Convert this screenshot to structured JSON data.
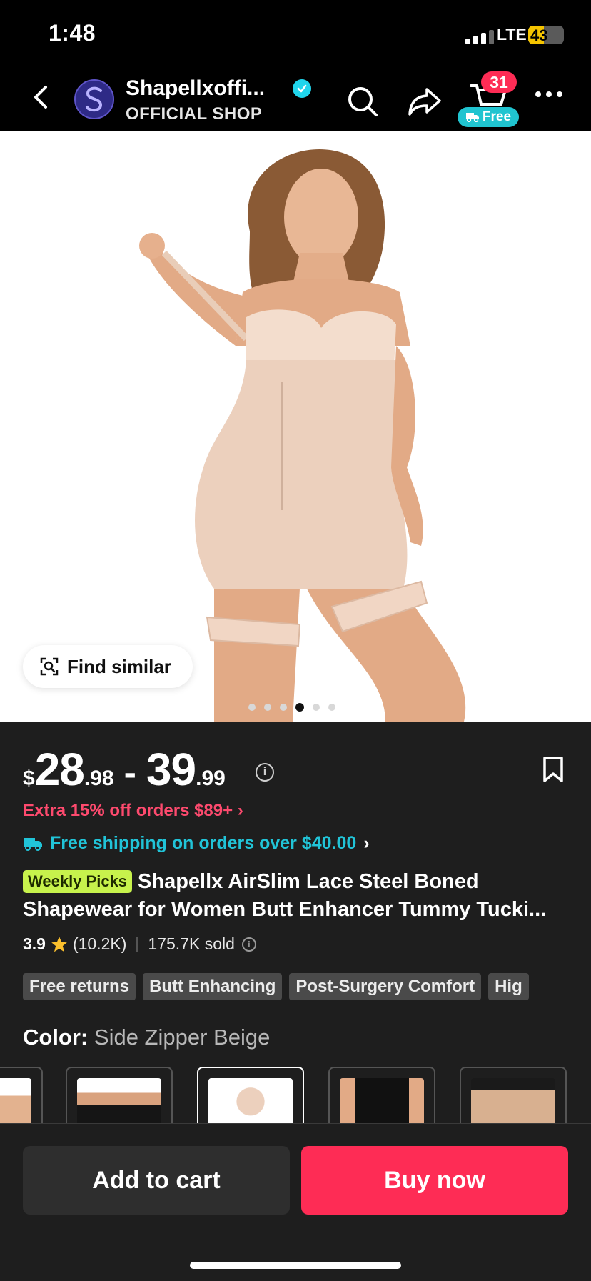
{
  "status_bar": {
    "time": "1:48",
    "network": "LTE",
    "battery": "43",
    "battery_level": 0.43
  },
  "header": {
    "shop_name": "Shapellxoffi...",
    "shop_subtitle": "OFFICIAL SHOP",
    "cart_count": "31",
    "cart_free_label": "Free"
  },
  "gallery": {
    "find_similar_label": "Find similar",
    "image_count": 6,
    "active_index": 3
  },
  "price": {
    "currency": "$",
    "min_whole": "28",
    "min_fraction": ".98",
    "separator": "-",
    "max_whole": "39",
    "max_fraction": ".99"
  },
  "promo": {
    "text": "Extra 15% off orders $89+"
  },
  "shipping": {
    "text": "Free shipping on orders over $40.00"
  },
  "product": {
    "badge": "Weekly Picks",
    "title_line1": "Shapellx AirSlim Lace Steel Boned",
    "title_line2": "Shapewear for Women Butt Enhancer Tummy Tucki..."
  },
  "rating": {
    "score": "3.9",
    "count": "(10.2K)",
    "sold": "175.7K sold"
  },
  "tags": [
    "Free returns",
    "Butt Enhancing",
    "Post-Surgery Comfort",
    "Hig"
  ],
  "color": {
    "label": "Color:",
    "value": "Side Zipper Beige"
  },
  "actions": {
    "add_to_cart": "Add to cart",
    "buy_now": "Buy now"
  },
  "colors": {
    "accent_red": "#fe2c55",
    "accent_cyan": "#20c4d0",
    "badge_green": "#c7f24c"
  }
}
